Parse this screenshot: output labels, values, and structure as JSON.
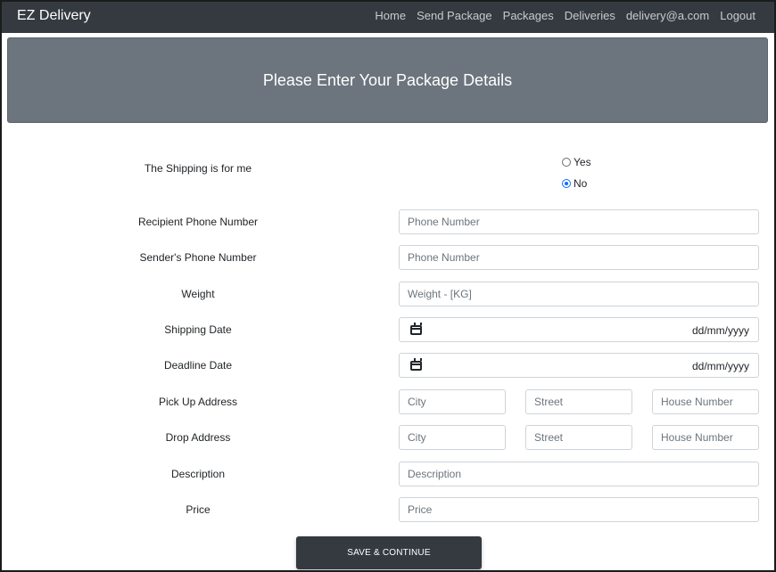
{
  "navbar": {
    "brand": "EZ Delivery",
    "links": [
      "Home",
      "Send Package",
      "Packages",
      "Deliveries",
      "delivery@a.com",
      "Logout"
    ]
  },
  "banner": {
    "title": "Please Enter Your Package Details"
  },
  "form": {
    "shipping_for_me": {
      "label": "The Shipping is for me",
      "options": [
        "Yes",
        "No"
      ],
      "selected": "No"
    },
    "recipient_phone": {
      "label": "Recipient Phone Number",
      "placeholder": "Phone Number",
      "value": ""
    },
    "sender_phone": {
      "label": "Sender's Phone Number",
      "placeholder": "Phone Number",
      "value": ""
    },
    "weight": {
      "label": "Weight",
      "placeholder": "Weight - [KG]",
      "value": ""
    },
    "shipping_date": {
      "label": "Shipping Date",
      "placeholder": "dd/mm/yyyy"
    },
    "deadline_date": {
      "label": "Deadline Date",
      "placeholder": "dd/mm/yyyy"
    },
    "pickup_address": {
      "label": "Pick Up Address",
      "city_placeholder": "City",
      "street_placeholder": "Street",
      "house_placeholder": "House Number"
    },
    "drop_address": {
      "label": "Drop Address",
      "city_placeholder": "City",
      "street_placeholder": "Street",
      "house_placeholder": "House Number"
    },
    "description": {
      "label": "Description",
      "placeholder": "Description",
      "value": ""
    },
    "price": {
      "label": "Price",
      "placeholder": "Price",
      "value": ""
    },
    "submit_label": "SAVE & CONTINUE"
  },
  "icons": {
    "date_picker": "calendar-icon"
  },
  "colors": {
    "navbar_bg": "#343a40",
    "banner_bg": "#6c757d",
    "radio_accent": "#0d6efd",
    "button_bg": "#343a40"
  }
}
